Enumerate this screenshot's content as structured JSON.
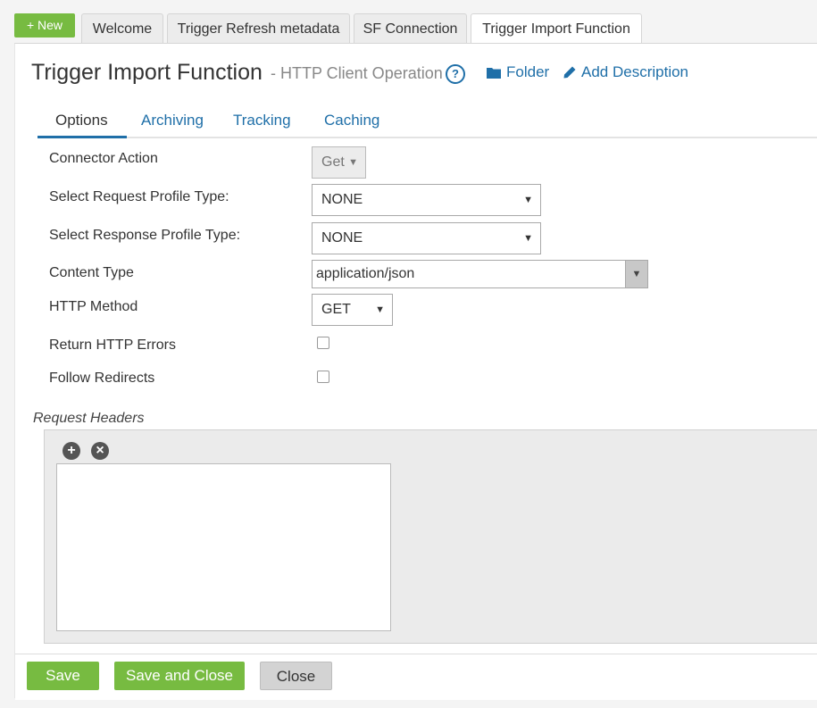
{
  "new_button": {
    "label": "+ New"
  },
  "tabs": [
    {
      "label": "Welcome"
    },
    {
      "label": "Trigger Refresh metadata"
    },
    {
      "label": "SF Connection"
    },
    {
      "label": "Trigger Import Function"
    }
  ],
  "header": {
    "title": "Trigger Import Function",
    "subtitle": "- HTTP Client Operation",
    "help_icon": "?",
    "folder_link": "Folder",
    "description_link": "Add Description"
  },
  "subtabs": [
    {
      "label": "Options"
    },
    {
      "label": "Archiving"
    },
    {
      "label": "Tracking"
    },
    {
      "label": "Caching"
    }
  ],
  "form": {
    "connector_action": {
      "label": "Connector Action",
      "value": "Get"
    },
    "request_profile": {
      "label": "Select Request Profile Type:",
      "value": "NONE"
    },
    "response_profile": {
      "label": "Select Response Profile Type:",
      "value": "NONE"
    },
    "content_type": {
      "label": "Content Type",
      "value": "application/json"
    },
    "http_method": {
      "label": "HTTP Method",
      "value": "GET"
    },
    "return_http_errors": {
      "label": "Return HTTP Errors",
      "checked": false
    },
    "follow_redirects": {
      "label": "Follow Redirects",
      "checked": false
    }
  },
  "request_headers": {
    "label": "Request Headers",
    "add_icon": "+",
    "remove_icon": "×"
  },
  "footer": {
    "save": "Save",
    "save_and_close": "Save and Close",
    "close": "Close"
  },
  "colors": {
    "accent_green": "#77bb41",
    "link_blue": "#1f6fa8"
  }
}
